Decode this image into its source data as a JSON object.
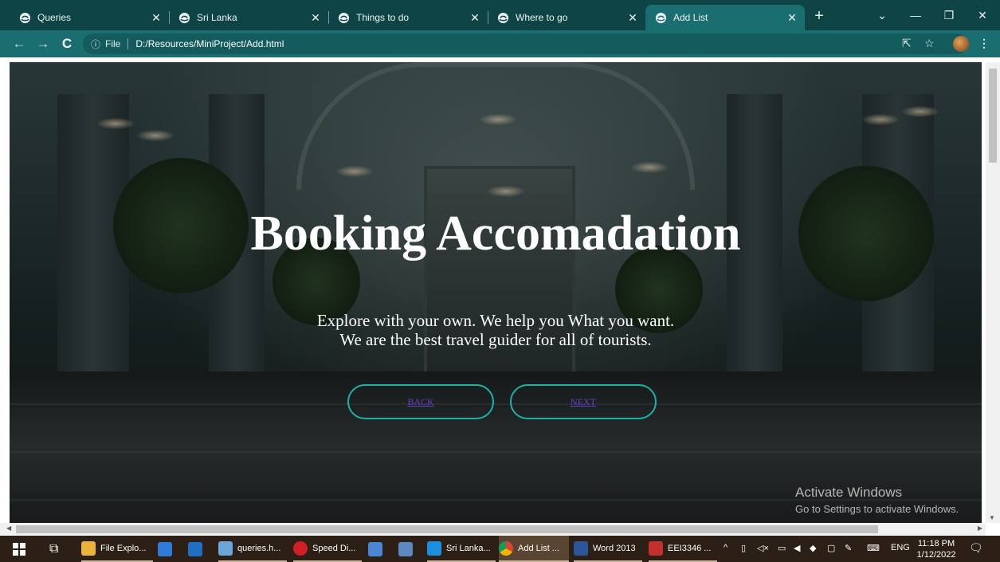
{
  "browser": {
    "tabs": [
      {
        "label": "Queries",
        "active": false
      },
      {
        "label": "Sri Lanka",
        "active": false
      },
      {
        "label": "Things to do",
        "active": false
      },
      {
        "label": "Where to go",
        "active": false
      },
      {
        "label": "Add List",
        "active": true
      }
    ],
    "omnibox": {
      "info_label": "File",
      "url": "D:/Resources/MiniProject/Add.html"
    }
  },
  "page": {
    "headline": "Booking Accomadation",
    "subline_1": "Explore with your own. We help you What you want.",
    "subline_2": "We are the best travel guider for all of tourists.",
    "back_button": "BACK",
    "next_button": "NEXT",
    "accent_color": "#1fb0a8"
  },
  "watermark": {
    "title": "Activate Windows",
    "subtitle": "Go to Settings to activate Windows."
  },
  "taskbar": {
    "items": [
      {
        "label": "File Explo..."
      },
      {
        "label": "queries.h..."
      },
      {
        "label": "Speed Di..."
      },
      {
        "label": "Sri Lanka..."
      },
      {
        "label": "Add List ..."
      },
      {
        "label": "Word 2013"
      },
      {
        "label": "EEI3346 ..."
      }
    ],
    "language": "ENG",
    "time": "11:18 PM",
    "date": "1/12/2022"
  }
}
